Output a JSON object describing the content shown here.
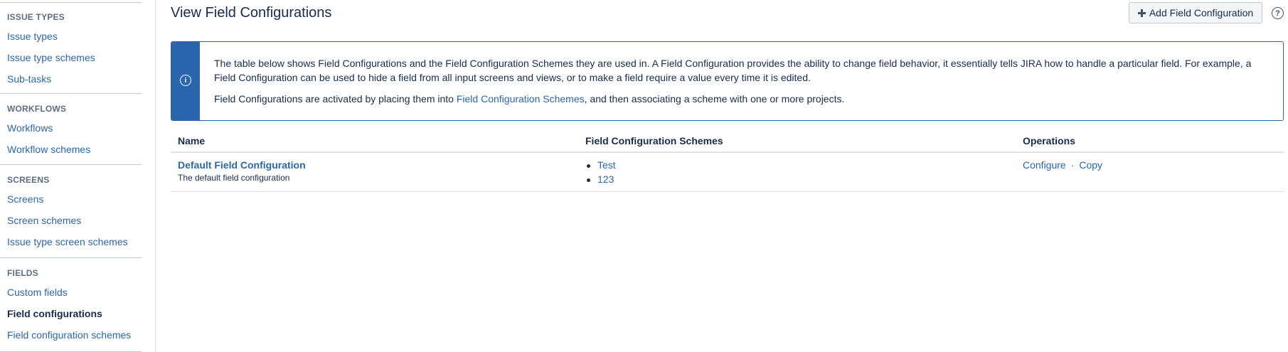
{
  "sidebar": {
    "sections": [
      {
        "heading": "ISSUE TYPES",
        "items": [
          {
            "label": "Issue types"
          },
          {
            "label": "Issue type schemes"
          },
          {
            "label": "Sub-tasks"
          }
        ]
      },
      {
        "heading": "WORKFLOWS",
        "items": [
          {
            "label": "Workflows"
          },
          {
            "label": "Workflow schemes"
          }
        ]
      },
      {
        "heading": "SCREENS",
        "items": [
          {
            "label": "Screens"
          },
          {
            "label": "Screen schemes"
          },
          {
            "label": "Issue type screen schemes"
          }
        ]
      },
      {
        "heading": "FIELDS",
        "items": [
          {
            "label": "Custom fields"
          },
          {
            "label": "Field configurations",
            "active": true
          },
          {
            "label": "Field configuration schemes"
          }
        ]
      }
    ]
  },
  "header": {
    "title": "View Field Configurations",
    "add_button_label": "Add Field Configuration",
    "help_icon": "question-circle-icon",
    "help_glyph": "?"
  },
  "info": {
    "icon": "info-icon",
    "icon_glyph": "i",
    "paragraph1": "The table below shows Field Configurations and the Field Configuration Schemes they are used in. A Field Configuration provides the ability to change field behavior, it essentially tells JIRA how to handle a particular field. For example, a Field Configuration can be used to hide a field from all input screens and views, or to make a field require a value every time it is edited.",
    "paragraph2_before": "Field Configurations are activated by placing them into ",
    "paragraph2_link": "Field Configuration Schemes",
    "paragraph2_after": ", and then associating a scheme with one or more projects."
  },
  "table": {
    "columns": [
      "Name",
      "Field Configuration Schemes",
      "Operations"
    ],
    "rows": [
      {
        "name": "Default Field Configuration",
        "description": "The default field configuration",
        "schemes": [
          "Test",
          "123"
        ],
        "operations": [
          "Configure",
          "Copy"
        ],
        "separator": "·"
      }
    ]
  },
  "colors": {
    "link": "#2a66ad",
    "text": "#172b4d",
    "info_accent": "#2a66ad"
  }
}
